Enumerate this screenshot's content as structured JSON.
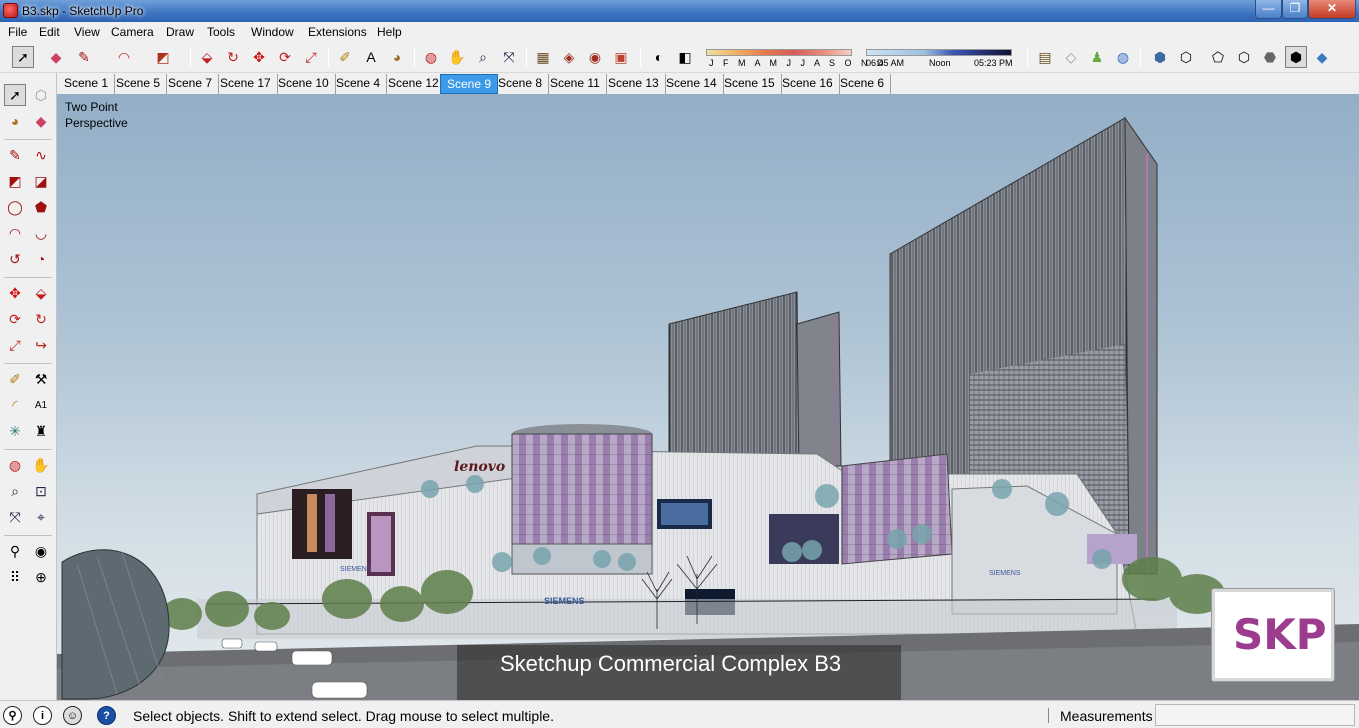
{
  "window": {
    "title": "B3.skp - SketchUp Pro",
    "minimize": "—",
    "maximize": "❐",
    "close": "✕"
  },
  "menu": [
    "File",
    "Edit",
    "View",
    "Camera",
    "Draw",
    "Tools",
    "Window",
    "Extensions",
    "Help"
  ],
  "shadow": {
    "months": "J F M A M J J A S O N D",
    "time_start": "06:45 AM",
    "time_noon": "Noon",
    "time_end": "05:23 PM"
  },
  "scenes": {
    "tabs": [
      "Scene 1",
      "Scene 5",
      "Scene 7",
      "Scene 17",
      "Scene 10",
      "Scene 4",
      "Scene 12",
      "Scene 9",
      "Scene 8",
      "Scene 11",
      "Scene 13",
      "Scene 14",
      "Scene 15",
      "Scene 16",
      "Scene 6"
    ],
    "active": "Scene 9"
  },
  "viewport": {
    "label_line1": "Two Point",
    "label_line2": "Perspective",
    "watermark": "Sketchup Commercial Complex B3",
    "logo": "SKP",
    "signs": {
      "lenovo": "lenovo",
      "siemens_1": "SIEMENS",
      "siemens_2": "SIEMENS",
      "siemens_3": "SIEMENS"
    }
  },
  "status": {
    "message": "Select objects. Shift to extend select. Drag mouse to select multiple.",
    "measurements_label": "Measurements",
    "measurements_value": ""
  },
  "colors": {
    "sky_top": "#93aec7",
    "scene_active": "#3d9ae8",
    "logo_purple": "#9b3c8e"
  }
}
